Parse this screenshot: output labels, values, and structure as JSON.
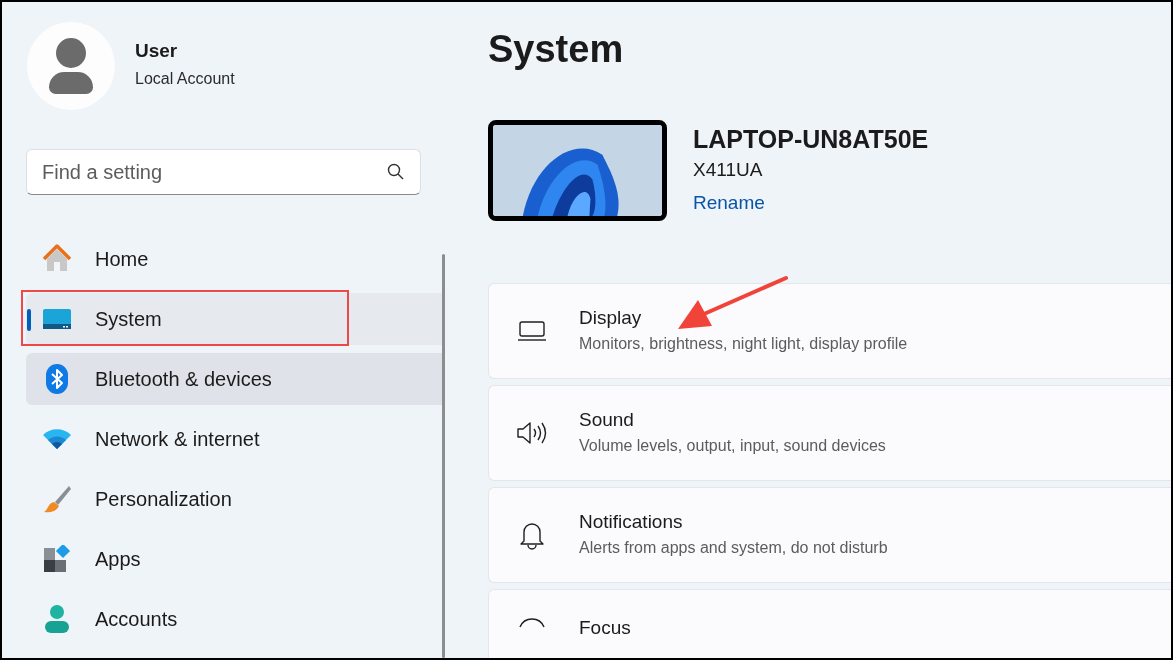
{
  "user": {
    "name": "User",
    "account": "Local Account"
  },
  "search": {
    "placeholder": "Find a setting"
  },
  "nav": [
    {
      "label": "Home",
      "kind": "home",
      "selected": false,
      "hovered": false
    },
    {
      "label": "System",
      "kind": "system",
      "selected": true,
      "hovered": false
    },
    {
      "label": "Bluetooth & devices",
      "kind": "bluetooth",
      "selected": false,
      "hovered": true
    },
    {
      "label": "Network & internet",
      "kind": "network",
      "selected": false,
      "hovered": false
    },
    {
      "label": "Personalization",
      "kind": "personalization",
      "selected": false,
      "hovered": false
    },
    {
      "label": "Apps",
      "kind": "apps",
      "selected": false,
      "hovered": false
    },
    {
      "label": "Accounts",
      "kind": "accounts",
      "selected": false,
      "hovered": false
    }
  ],
  "page_title": "System",
  "device": {
    "name": "LAPTOP-UN8AT50E",
    "model": "X411UA",
    "rename": "Rename"
  },
  "cards": [
    {
      "kind": "display",
      "title": "Display",
      "subtitle": "Monitors, brightness, night light, display profile"
    },
    {
      "kind": "sound",
      "title": "Sound",
      "subtitle": "Volume levels, output, input, sound devices"
    },
    {
      "kind": "notifications",
      "title": "Notifications",
      "subtitle": "Alerts from apps and system, do not disturb"
    },
    {
      "kind": "focus",
      "title": "Focus"
    }
  ]
}
